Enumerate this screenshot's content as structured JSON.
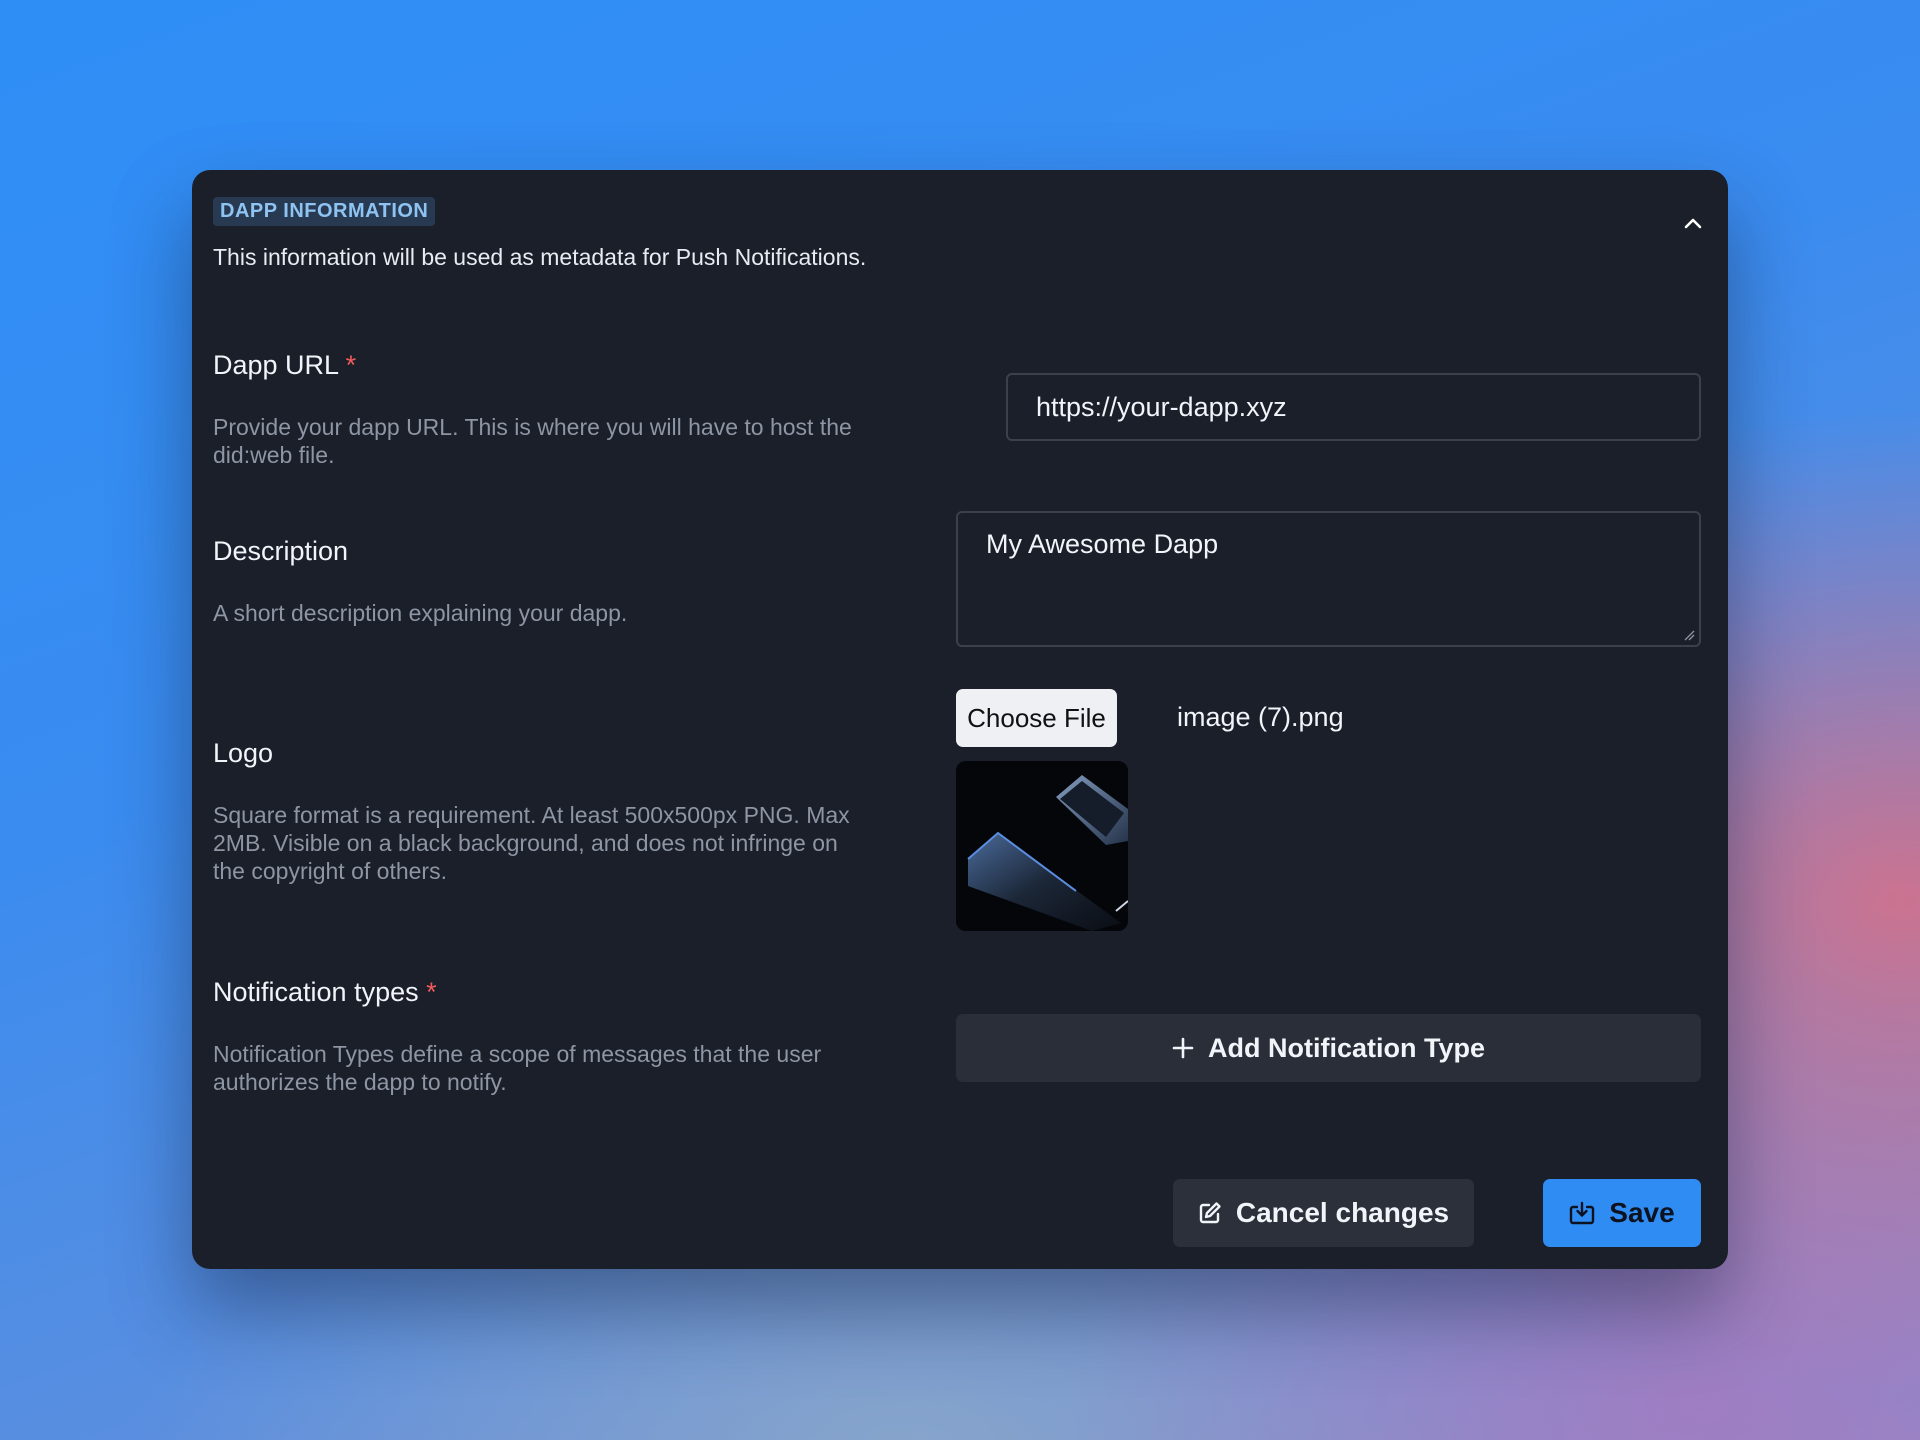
{
  "section": {
    "tag": "DAPP INFORMATION",
    "subtitle": "This information will be used as metadata for Push Notifications."
  },
  "fields": {
    "dapp_url": {
      "label": "Dapp URL",
      "required_mark": "*",
      "help": "Provide your dapp URL. This is where you will have to host the did:web file.",
      "value": "https://your-dapp.xyz"
    },
    "description": {
      "label": "Description",
      "help": "A short description explaining your dapp.",
      "value": "My Awesome Dapp"
    },
    "logo": {
      "label": "Logo",
      "help": "Square format is a requirement. At least 500x500px PNG. Max 2MB. Visible on a black background, and does not infringe on the copyright of others.",
      "choose_label": "Choose File",
      "file_name": "image (7).png"
    },
    "notification_types": {
      "label": "Notification types",
      "required_mark": "*",
      "help": "Notification Types define a scope of messages that the user authorizes the dapp to notify.",
      "add_label": "Add Notification Type"
    }
  },
  "actions": {
    "cancel_label": "Cancel changes",
    "save_label": "Save"
  },
  "icons": {
    "collapse": "chevron-up-icon",
    "add": "plus-icon",
    "cancel": "edit-icon",
    "save": "download-save-icon"
  },
  "colors": {
    "card_bg": "#1b1f2a",
    "accent": "#2f8cf2",
    "required": "#ef5b5b",
    "tag_text": "#8fc3f2"
  }
}
